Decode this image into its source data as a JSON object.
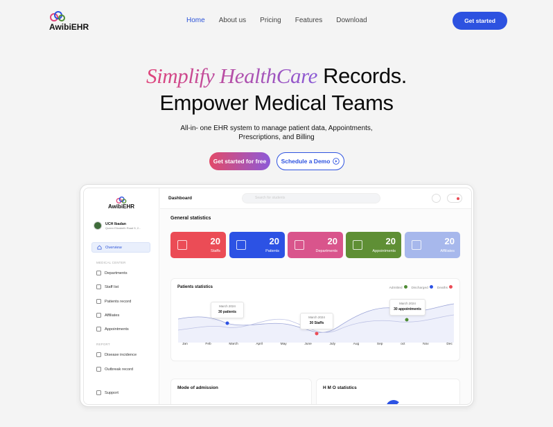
{
  "nav": {
    "brand": "AwibiEHR",
    "links": [
      {
        "label": "Home",
        "active": true
      },
      {
        "label": "About us"
      },
      {
        "label": "Pricing"
      },
      {
        "label": "Features"
      },
      {
        "label": "Download"
      }
    ],
    "cta": "Get started"
  },
  "hero": {
    "title_grad": "Simplify HealthCare",
    "title_rest": " Records.",
    "title2": "Empower Medical Teams",
    "subtitle_line1": "All-in- one EHR system to manage patient data, Appointments,",
    "subtitle_line2": "Prescriptions, and Billing",
    "cta_primary": "Get started for free",
    "cta_secondary": "Schedule a Demo"
  },
  "colors": {
    "accent": "#2d52e0",
    "grad_start": "#e0447a",
    "grad_end": "#8a5bd6"
  },
  "app": {
    "brand": "AwibiEHR",
    "org_name": "UCH Ibadan",
    "org_address": "Queen Elizabeth Road 5, 2...",
    "sidebar": {
      "overview": "Overview",
      "section1": "MEDICAL CENTER",
      "items": [
        "Departments",
        "Staff list",
        "Patients record",
        "Affiliates",
        "Appointments"
      ],
      "section2": "REPORT",
      "report_items": [
        "Disease incidence",
        "Outbreak record"
      ],
      "support": "Support"
    },
    "header": {
      "title": "Dashboard",
      "search_placeholder": "Search for students"
    },
    "general_statistics": "General statistics",
    "cards": [
      {
        "value": "20",
        "label": "Staffs",
        "color": "#eb4c56"
      },
      {
        "value": "20",
        "label": "Patients",
        "color": "#2c52e4"
      },
      {
        "value": "20",
        "label": "Departments",
        "color": "#d9558c"
      },
      {
        "value": "20",
        "label": "Appointments",
        "color": "#5f8f35"
      },
      {
        "value": "20",
        "label": "Affiliates",
        "color": "#a7b8ec"
      }
    ],
    "patients_stats": {
      "title": "Patients statistics",
      "legend": [
        {
          "label": "Admitted",
          "color": "#4e8b34"
        },
        {
          "label": "Discharged",
          "color": "#2c52e4"
        },
        {
          "label": "Deaths",
          "color": "#eb4c56"
        }
      ],
      "months": [
        "Jan",
        "Feb",
        "March",
        "April",
        "May",
        "June",
        "July",
        "Aug",
        "Sep",
        "oct",
        "Nov",
        "Dec"
      ],
      "tooltips": [
        {
          "date": "March 2024",
          "text": "30 patients"
        },
        {
          "date": "March 2024",
          "text": "30 Staffs"
        },
        {
          "date": "March 2024",
          "text": "30 appointments"
        }
      ]
    },
    "mode_of_admission": "Mode of admission",
    "hmo_statistics": "H M O statistics"
  }
}
